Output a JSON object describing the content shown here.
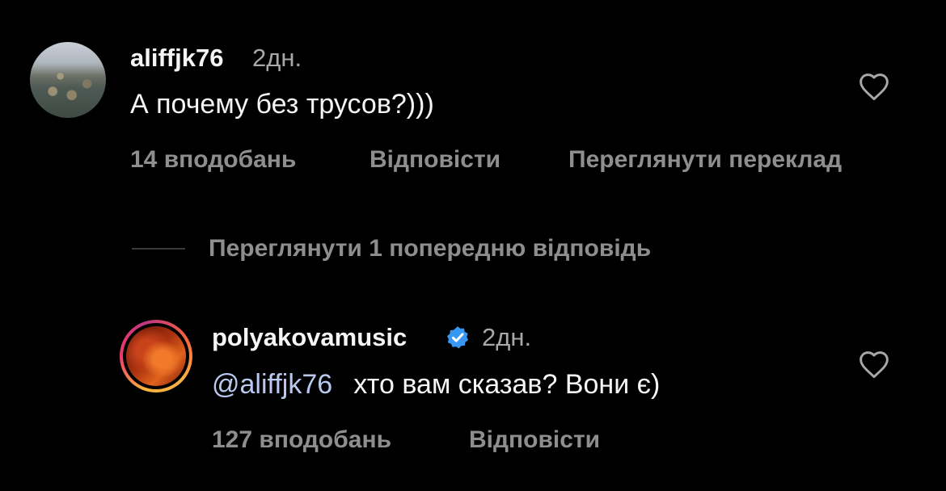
{
  "comment": {
    "username": "aliffjk76",
    "time": "2дн.",
    "text": "А почему без трусов?)))",
    "likes": "14 вподобань",
    "reply_label": "Відповісти",
    "translate_label": "Переглянути переклад",
    "icons": {
      "avatar": "avatar",
      "like": "heart-icon"
    }
  },
  "replies_toggle": {
    "label": "Переглянути 1 попередню відповідь"
  },
  "reply": {
    "username": "polyakovamusic",
    "time": "2дн.",
    "mention": "@aliffjk76",
    "text": "хто вам сказав? Вони є)",
    "likes": "127 вподобань",
    "reply_label": "Відповісти",
    "icons": {
      "avatar": "avatar",
      "verified": "verified-badge-icon",
      "like": "heart-icon"
    }
  },
  "colors": {
    "background": "#000000",
    "primary_text": "#f5f5f5",
    "secondary_text": "#8e8e8e",
    "mention": "#b9c9ee",
    "verified": "#3897f0"
  }
}
